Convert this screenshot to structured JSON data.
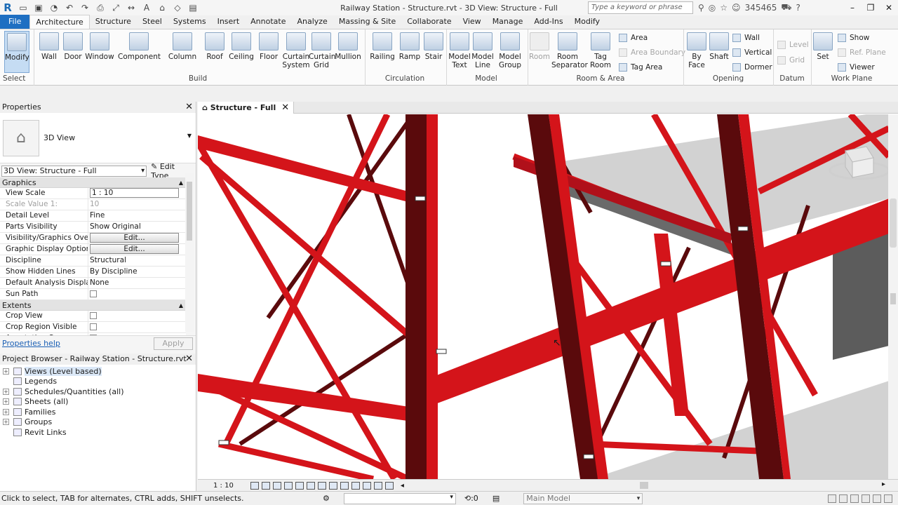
{
  "app": {
    "title": "Railway Station - Structure.rvt - 3D View: Structure - Full",
    "search_placeholder": "Type a keyword or phrase",
    "user_id": "345465"
  },
  "menu_tabs": [
    "File",
    "Architecture",
    "Structure",
    "Steel",
    "Systems",
    "Insert",
    "Annotate",
    "Analyze",
    "Massing & Site",
    "Collaborate",
    "View",
    "Manage",
    "Add-Ins",
    "Modify"
  ],
  "ribbon": {
    "modify": "Modify",
    "select": "Select",
    "build": {
      "label": "Build",
      "items": [
        "Wall",
        "Door",
        "Window",
        "Component",
        "Column",
        "Roof",
        "Ceiling",
        "Floor",
        "Curtain System",
        "Curtain Grid",
        "Mullion"
      ]
    },
    "circulation": {
      "label": "Circulation",
      "items": [
        "Railing",
        "Ramp",
        "Stair"
      ]
    },
    "model": {
      "label": "Model",
      "items": [
        "Model Text",
        "Model Line",
        "Model Group"
      ]
    },
    "room_area": {
      "label": "Room & Area",
      "items": [
        "Room",
        "Room Separator",
        "Tag Room"
      ],
      "small": [
        "Area",
        "Area Boundary",
        "Tag Area"
      ]
    },
    "opening": {
      "label": "Opening",
      "items": [
        "By Face",
        "Shaft"
      ],
      "small": [
        "Wall",
        "Vertical",
        "Dormer"
      ]
    },
    "datum": {
      "label": "Datum",
      "small": [
        "Level",
        "Grid"
      ]
    },
    "workplane": {
      "label": "Work Plane",
      "items": [
        "Set"
      ],
      "small": [
        "Show",
        "Ref. Plane",
        "Viewer"
      ]
    }
  },
  "properties": {
    "title": "Properties",
    "type_name": "3D View",
    "instance_selector": "3D View: Structure - Full",
    "edit_type": "Edit Type",
    "groups": [
      {
        "name": "Graphics",
        "rows": [
          {
            "k": "View Scale",
            "v": "1 : 10",
            "kind": "box"
          },
          {
            "k": "Scale Value    1:",
            "v": "10",
            "kind": "text",
            "dim": true
          },
          {
            "k": "Detail Level",
            "v": "Fine",
            "kind": "text"
          },
          {
            "k": "Parts Visibility",
            "v": "Show Original",
            "kind": "text"
          },
          {
            "k": "Visibility/Graphics Overri...",
            "v": "Edit...",
            "kind": "btn"
          },
          {
            "k": "Graphic Display Options",
            "v": "Edit...",
            "kind": "btn"
          },
          {
            "k": "Discipline",
            "v": "Structural",
            "kind": "text"
          },
          {
            "k": "Show Hidden Lines",
            "v": "By Discipline",
            "kind": "text"
          },
          {
            "k": "Default Analysis Display ...",
            "v": "None",
            "kind": "text"
          },
          {
            "k": "Sun Path",
            "v": "",
            "kind": "chk"
          }
        ]
      },
      {
        "name": "Extents",
        "rows": [
          {
            "k": "Crop View",
            "v": "",
            "kind": "chk"
          },
          {
            "k": "Crop Region Visible",
            "v": "",
            "kind": "chk"
          },
          {
            "k": "Annotation Crop",
            "v": "",
            "kind": "chk"
          }
        ]
      }
    ],
    "help": "Properties help",
    "apply": "Apply"
  },
  "project_browser": {
    "title": "Project Browser - Railway Station - Structure.rvt",
    "items": [
      {
        "label": "Views (Level based)",
        "exp": true
      },
      {
        "label": "Legends",
        "exp": false
      },
      {
        "label": "Schedules/Quantities (all)",
        "exp": true
      },
      {
        "label": "Sheets (all)",
        "exp": true
      },
      {
        "label": "Families",
        "exp": true
      },
      {
        "label": "Groups",
        "exp": true
      },
      {
        "label": "Revit Links",
        "exp": false
      }
    ]
  },
  "view": {
    "tab": "Structure - Full",
    "scale": "1 : 10"
  },
  "status": {
    "message": "Click to select, TAB for alternates, CTRL adds, SHIFT unselects.",
    "filter_count": ":0",
    "model": "Main Model"
  },
  "colors": {
    "steel_red": "#d4141a",
    "steel_dark": "#5a0a0c",
    "slab": "#cfcfcf",
    "accent": "#1e6fc2"
  }
}
